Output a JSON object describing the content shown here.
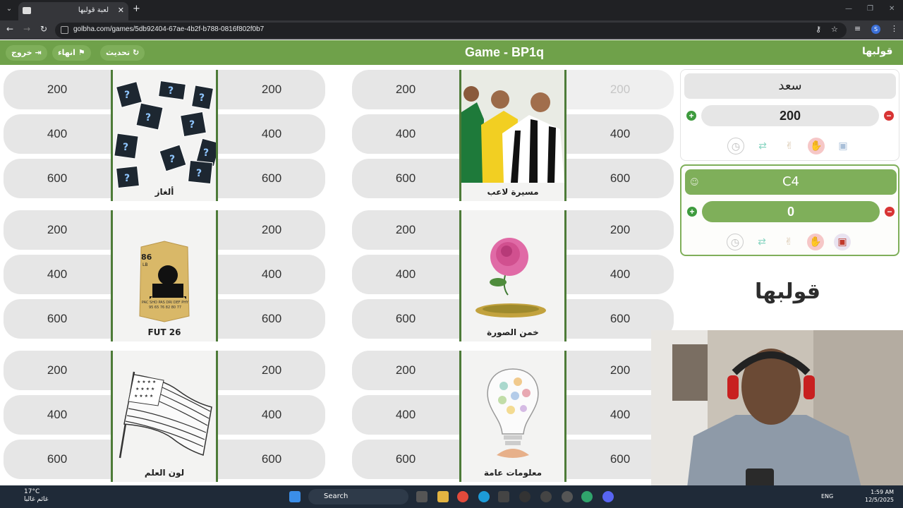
{
  "browser": {
    "tab_title": "لعبة قولبها",
    "url": "golbha.com/games/5db92404-67ae-4b2f-b788-0816f802f0b7",
    "profile_initial": "S"
  },
  "game_bar": {
    "exit_label": "خروج",
    "finish_label": "انهاء",
    "refresh_label": "تحديث",
    "title": "Game - BP1q",
    "brand": "قولبها"
  },
  "categories": [
    {
      "label": "ألغاز",
      "left_values": [
        "200",
        "400",
        "600"
      ],
      "right_values": [
        "200",
        "400",
        "600"
      ]
    },
    {
      "label": "مسيرة لاعب",
      "left_values": [
        "200",
        "400",
        "600"
      ],
      "right_values": [
        "200",
        "400",
        "600"
      ]
    },
    {
      "label": "FUT 26",
      "left_values": [
        "200",
        "400",
        "600"
      ],
      "right_values": [
        "200",
        "400",
        "600"
      ]
    },
    {
      "label": "خمن الصورة",
      "left_values": [
        "200",
        "400",
        "600"
      ],
      "right_values": [
        "200",
        "400",
        "600"
      ]
    },
    {
      "label": "لون العلم",
      "left_values": [
        "200",
        "400",
        "600"
      ],
      "right_values": [
        "200",
        "400",
        "600"
      ]
    },
    {
      "label": "معلومات عامة",
      "left_values": [
        "200",
        "400",
        "600"
      ],
      "right_values": [
        "200",
        "400",
        "600"
      ]
    }
  ],
  "fut_card": {
    "rating": "86",
    "position": "LB",
    "stats": "PAC SHO PAS DRI DEF PHY",
    "stat_values": "95 65 76 82 80 77"
  },
  "teams": [
    {
      "name": "سعد",
      "score": "200",
      "active": false
    },
    {
      "name": "C4",
      "score": "0",
      "active": true
    }
  ],
  "brand_logo": "قولبها",
  "taskbar": {
    "temperature": "17°C",
    "weather": "غائم غالبا",
    "search_placeholder": "Search",
    "lang": "ENG",
    "time": "1:59 AM",
    "date": "12/5/2025"
  }
}
